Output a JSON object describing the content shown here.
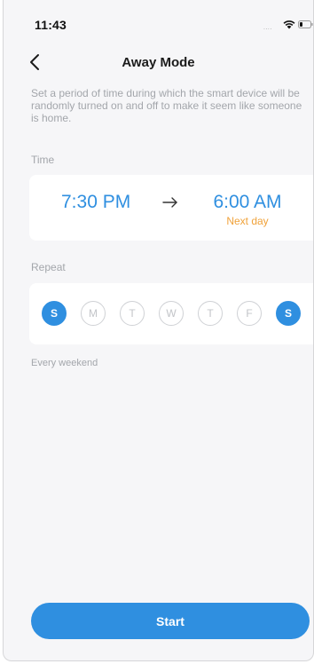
{
  "status_bar": {
    "time": "11:43",
    "signal": "....",
    "icons": [
      "signal-dots-icon",
      "wifi-icon",
      "battery-icon"
    ]
  },
  "header": {
    "title": "Away Mode",
    "back_icon": "chevron-left-icon"
  },
  "description": "Set a period of time during which the smart device will be randomly turned on and off to make it seem like someone is home.",
  "time_section": {
    "label": "Time",
    "start_time": "7:30 PM",
    "arrow_icon": "arrow-right-icon",
    "end_time": "6:00 AM",
    "end_note": "Next day"
  },
  "repeat_section": {
    "label": "Repeat",
    "days": [
      {
        "label": "S",
        "selected": true
      },
      {
        "label": "M",
        "selected": false
      },
      {
        "label": "T",
        "selected": false
      },
      {
        "label": "W",
        "selected": false
      },
      {
        "label": "T",
        "selected": false
      },
      {
        "label": "F",
        "selected": false
      },
      {
        "label": "S",
        "selected": true
      }
    ],
    "summary": "Every weekend"
  },
  "actions": {
    "start_label": "Start"
  },
  "colors": {
    "accent": "#2f8fe0",
    "warning": "#f0a23a",
    "muted_text": "#a3a6ab",
    "background": "#f6f6f8"
  }
}
